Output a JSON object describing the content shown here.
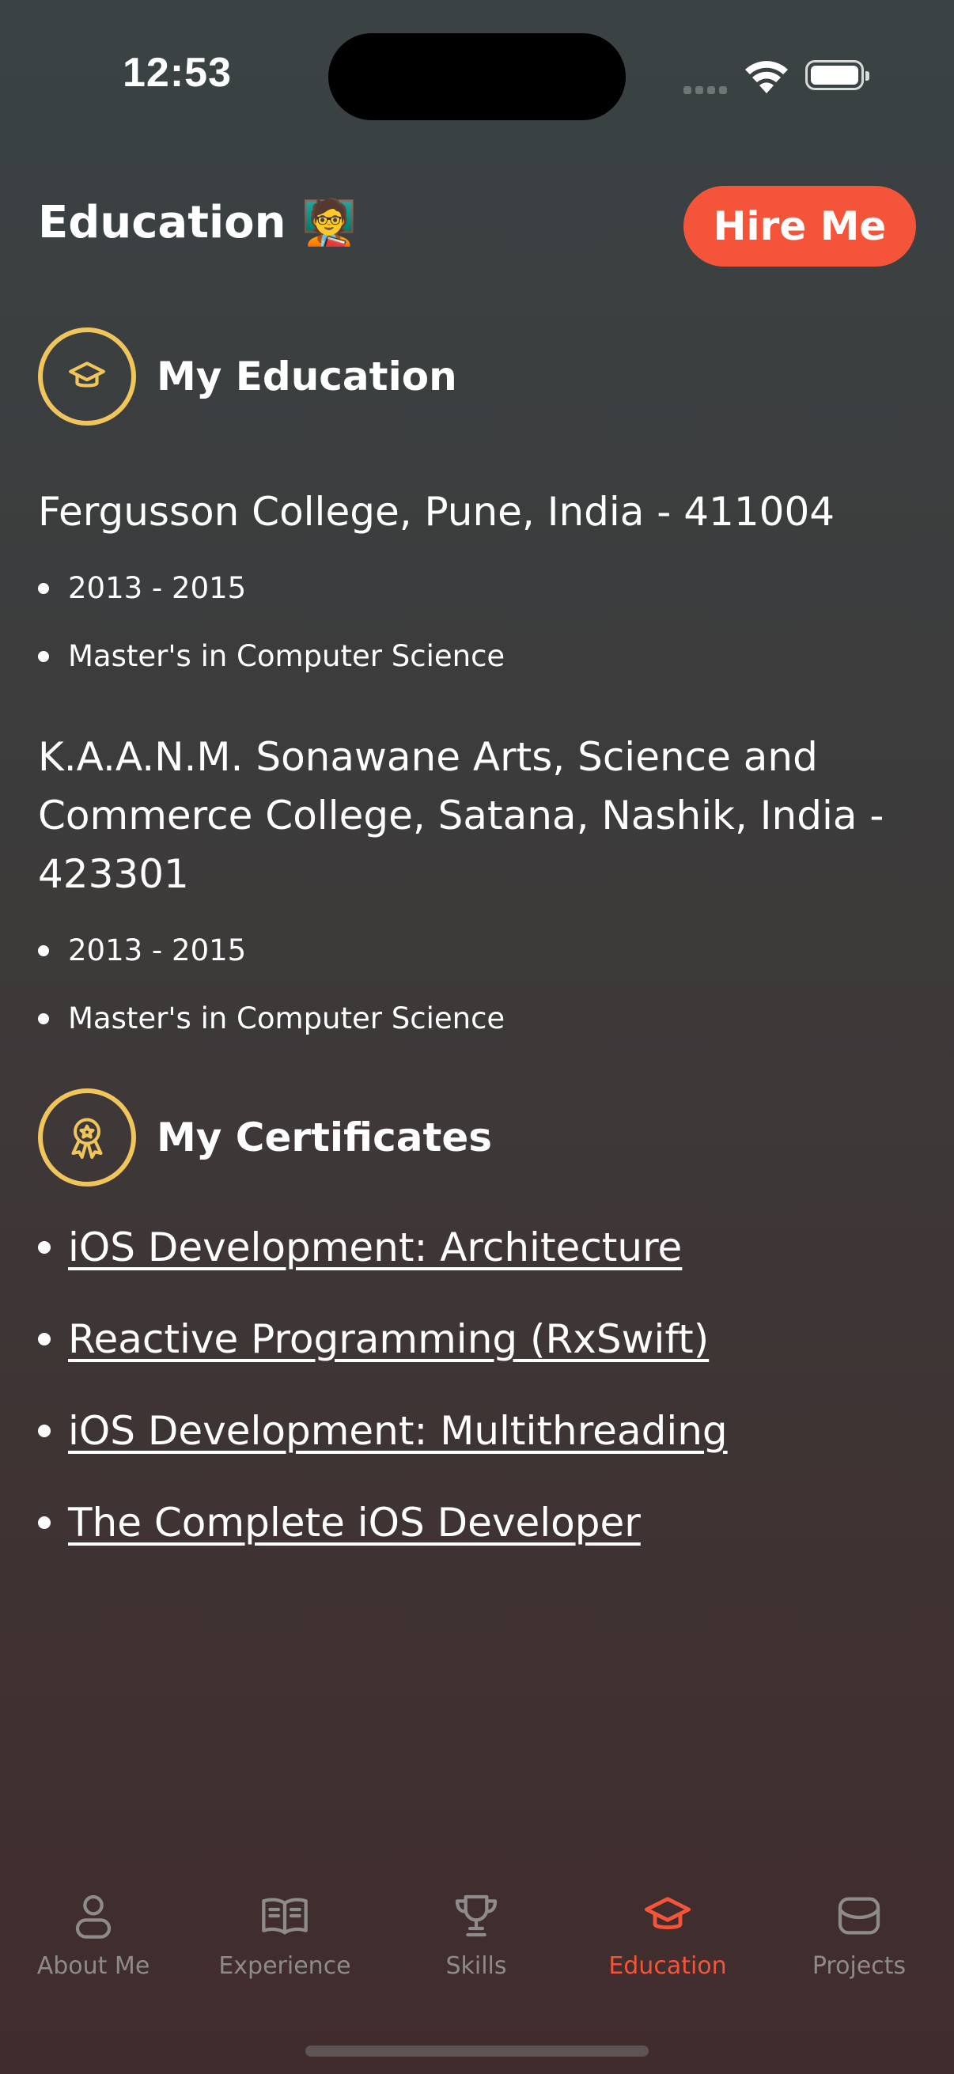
{
  "status_bar": {
    "time": "12:53"
  },
  "header": {
    "title": "Education 🧑‍🏫",
    "hire_button": "Hire Me"
  },
  "education": {
    "title": "My Education",
    "items": [
      {
        "school": "Fergusson College, Pune, India - 411004",
        "years": "2013 - 2015",
        "degree": "Master's in Computer Science"
      },
      {
        "school": "K.A.A.N.M. Sonawane Arts, Science and Commerce College, Satana, Nashik, India - 423301",
        "years": "2013 - 2015",
        "degree": "Master's in Computer Science"
      }
    ]
  },
  "certificates": {
    "title": "My Certificates",
    "items": [
      "iOS Development: Architecture",
      "Reactive Programming (RxSwift)",
      "iOS Development: Multithreading",
      "The Complete iOS Developer"
    ]
  },
  "tabs": [
    {
      "label": "About Me",
      "icon": "person-icon"
    },
    {
      "label": "Experience",
      "icon": "book-icon"
    },
    {
      "label": "Skills",
      "icon": "trophy-icon"
    },
    {
      "label": "Education",
      "icon": "graduation-cap-icon",
      "active": true
    },
    {
      "label": "Projects",
      "icon": "tray-icon"
    }
  ],
  "colors": {
    "accent": "#f4553a",
    "gold": "#efc55c",
    "inactive": "#8e8b8b"
  }
}
